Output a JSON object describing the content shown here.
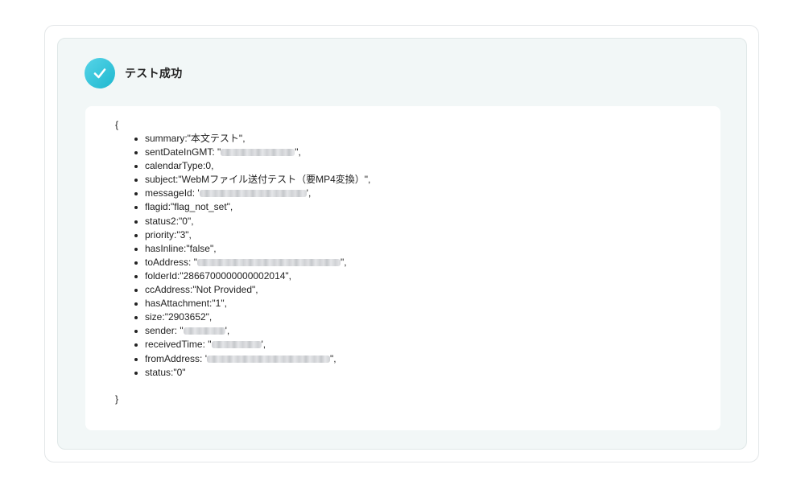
{
  "result": {
    "title": "テスト成功",
    "status_icon": "check-icon",
    "accent_color": "#2bbfd4"
  },
  "json_view": {
    "open_brace": "{",
    "close_brace": "}",
    "fields": [
      {
        "key": "summary",
        "prefix": "summary: ",
        "value": "\"本文テスト\",",
        "redacted": false
      },
      {
        "key": "sentDateInGMT",
        "prefix": "sentDateInGMT: \"",
        "value": "\",",
        "redacted": true
      },
      {
        "key": "calendarType",
        "prefix": "calendarType: ",
        "value": "0,",
        "redacted": false
      },
      {
        "key": "subject",
        "prefix": "subject: ",
        "value": "\"WebMファイル送付テスト（要MP4変換）\",",
        "redacted": false
      },
      {
        "key": "messageId",
        "prefix": "messageId: '",
        "value": "',",
        "redacted": true
      },
      {
        "key": "flagid",
        "prefix": "flagid: ",
        "value": "\"flag_not_set\",",
        "redacted": false
      },
      {
        "key": "status2",
        "prefix": "status2: ",
        "value": "\"0\",",
        "redacted": false
      },
      {
        "key": "priority",
        "prefix": "priority: ",
        "value": "\"3\",",
        "redacted": false
      },
      {
        "key": "hasInline",
        "prefix": "hasInline: ",
        "value": "\"false\",",
        "redacted": false
      },
      {
        "key": "toAddress",
        "prefix": "toAddress: \"",
        "value": "\",",
        "redacted": true
      },
      {
        "key": "folderId",
        "prefix": "folderId: ",
        "value": "\"2866700000000002014\",",
        "redacted": false
      },
      {
        "key": "ccAddress",
        "prefix": "ccAddress: ",
        "value": "\"Not Provided\",",
        "redacted": false
      },
      {
        "key": "hasAttachment",
        "prefix": "hasAttachment: ",
        "value": "\"1\",",
        "redacted": false
      },
      {
        "key": "size",
        "prefix": "size: ",
        "value": "\"2903652\",",
        "redacted": false
      },
      {
        "key": "sender",
        "prefix": "sender: \"",
        "value": "',",
        "redacted": true
      },
      {
        "key": "receivedTime",
        "prefix": "receivedTime: \"",
        "value": "',",
        "redacted": true
      },
      {
        "key": "fromAddress",
        "prefix": "fromAddress: '",
        "value": "\",",
        "redacted": true
      },
      {
        "key": "status",
        "prefix": "status: ",
        "value": "\"0\"",
        "redacted": false
      }
    ]
  }
}
